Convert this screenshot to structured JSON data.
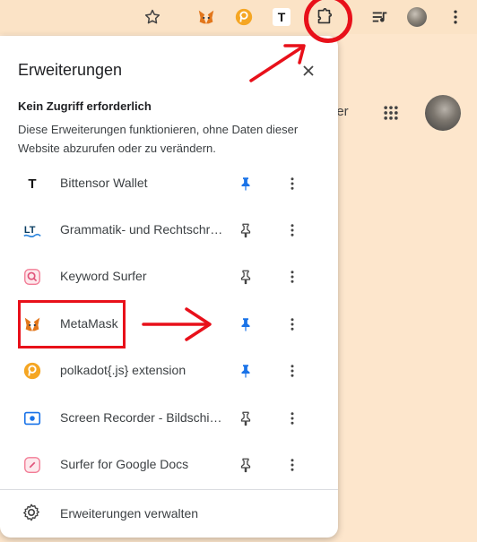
{
  "toolbar": {
    "icons": [
      "star-icon",
      "metamask-icon",
      "polkadot-icon",
      "bittensor-icon",
      "extensions-puzzle-icon",
      "media-control-icon",
      "profile-avatar",
      "kebab-menu-icon"
    ],
    "bittensor_glyph": "T"
  },
  "page": {
    "partial_text": "ler"
  },
  "popup": {
    "title": "Erweiterungen",
    "section_heading": "Kein Zugriff erforderlich",
    "section_description": "Diese Erweiterungen funktionieren, ohne Daten dieser Website abzurufen oder zu verändern.",
    "extensions": [
      {
        "name": "Bittensor Wallet",
        "icon": "bittensor-icon",
        "pinned": true
      },
      {
        "name": "Grammatik- und Rechtschreibprüfung",
        "icon": "languagetool-icon",
        "pinned": false
      },
      {
        "name": "Keyword Surfer",
        "icon": "keyword-surfer-icon",
        "pinned": false
      },
      {
        "name": "MetaMask",
        "icon": "metamask-icon",
        "pinned": true
      },
      {
        "name": "polkadot{.js} extension",
        "icon": "polkadot-icon",
        "pinned": true
      },
      {
        "name": "Screen Recorder - Bildschirmaufnahme",
        "icon": "screen-recorder-icon",
        "pinned": false
      },
      {
        "name": "Surfer for Google Docs",
        "icon": "surfer-docs-icon",
        "pinned": false
      }
    ],
    "manage_label": "Erweiterungen verwalten"
  },
  "colors": {
    "accent_pin": "#1a73e8",
    "annotation": "#e8101a",
    "background": "#fbe3c6",
    "metamask": "#e2761b",
    "polkadot": "#f5a623"
  }
}
